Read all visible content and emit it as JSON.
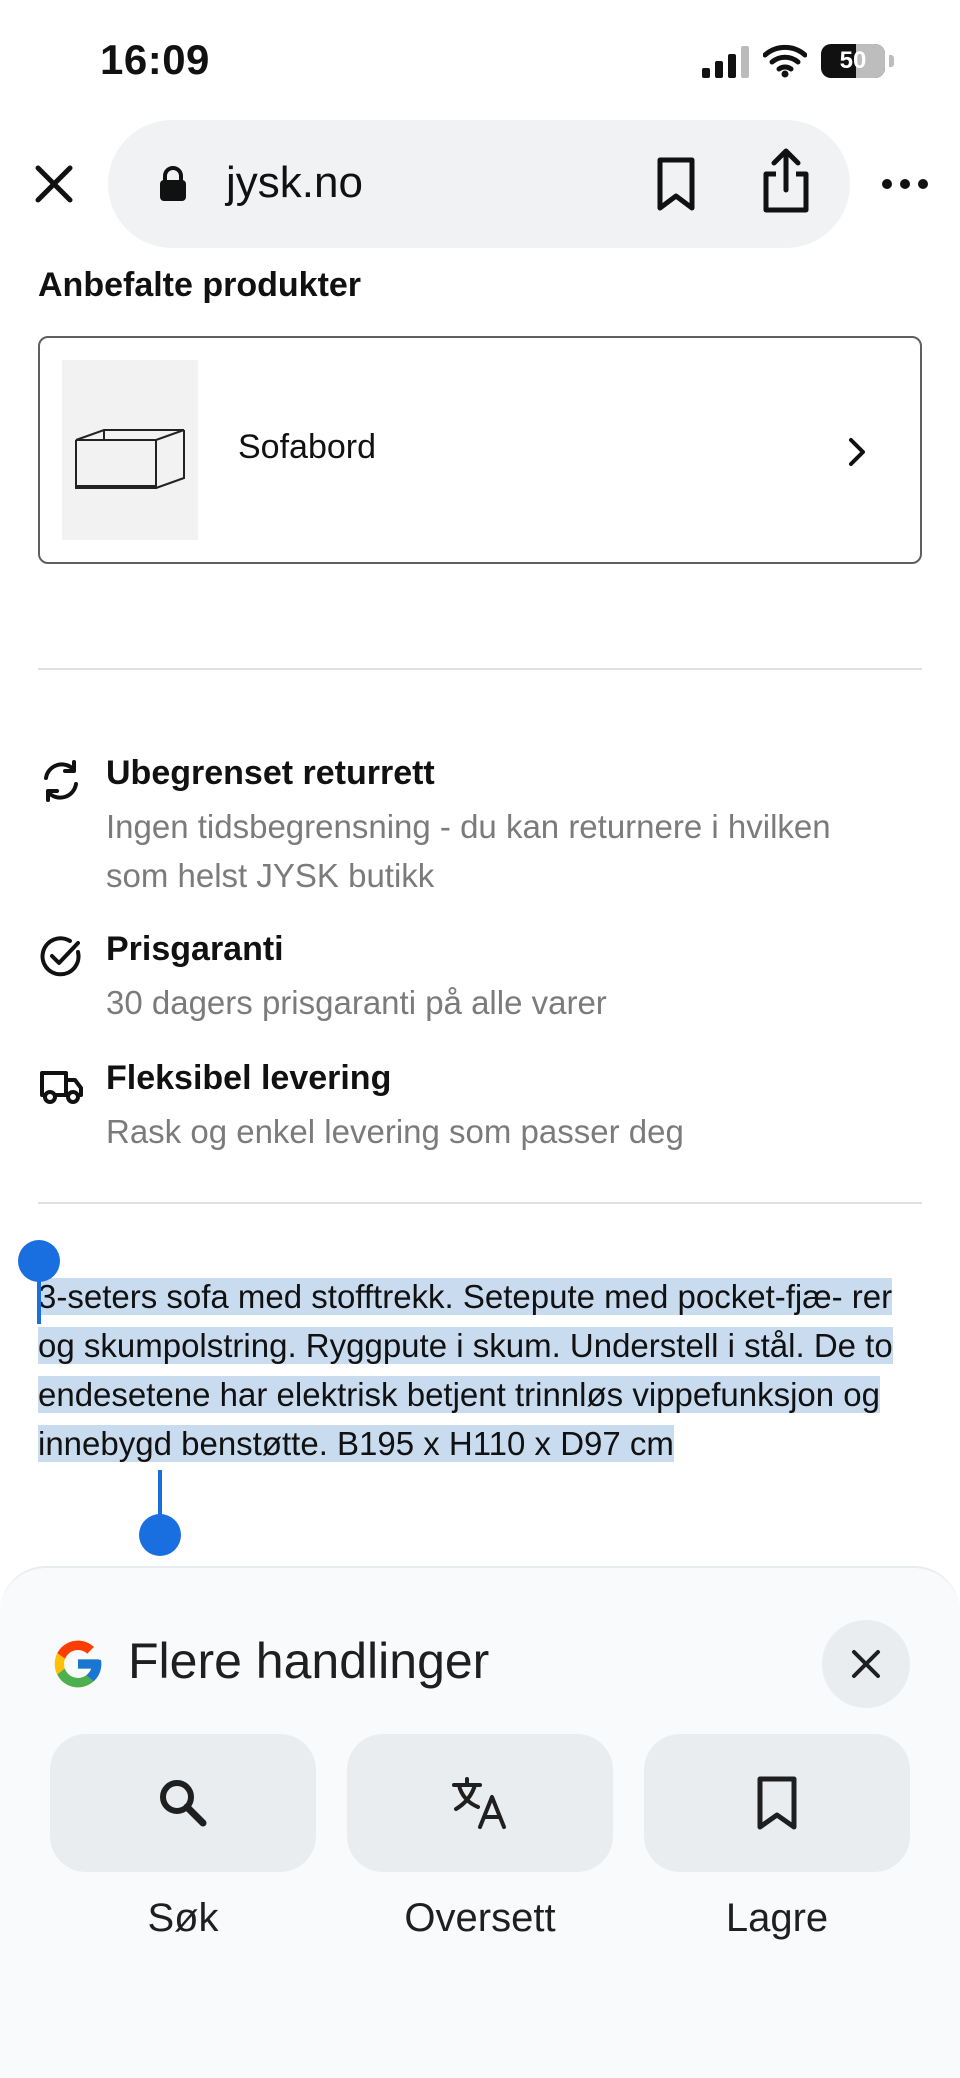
{
  "status_bar": {
    "time": "16:09",
    "battery": "50"
  },
  "browser": {
    "url": "jysk.no"
  },
  "recommended": {
    "title": "Anbefalte produkter",
    "product_name": "Sofabord"
  },
  "benefits": [
    {
      "title": "Ubegrenset returrett",
      "desc": "Ingen tidsbegrensning - du kan returnere i hvilken som helst JYSK butikk",
      "icon": "refresh-icon"
    },
    {
      "title": "Prisgaranti",
      "desc": "30 dagers prisgaranti på alle varer",
      "icon": "check-circle-icon"
    },
    {
      "title": "Fleksibel levering",
      "desc": "Rask og enkel levering som passer deg",
      "icon": "truck-icon"
    }
  ],
  "description": "3-seters sofa med stofftrekk. Setepute med pocket-fjæ- rer og skumpolstring. Ryggpute i skum. Understell i stål. De to endesetene har elektrisk betjent trinnløs vippefunksjon og innebygd benstøtte. B195 x H110 x D97 cm",
  "sheet": {
    "title": "Flere handlinger",
    "actions": [
      {
        "label": "Søk",
        "icon": "search-icon"
      },
      {
        "label": "Oversett",
        "icon": "translate-icon"
      },
      {
        "label": "Lagre",
        "icon": "bookmark-icon"
      }
    ]
  },
  "colors": {
    "selection": "#c9dcef",
    "handle": "#1a6fe0",
    "muted_text": "#7b7b7b"
  }
}
